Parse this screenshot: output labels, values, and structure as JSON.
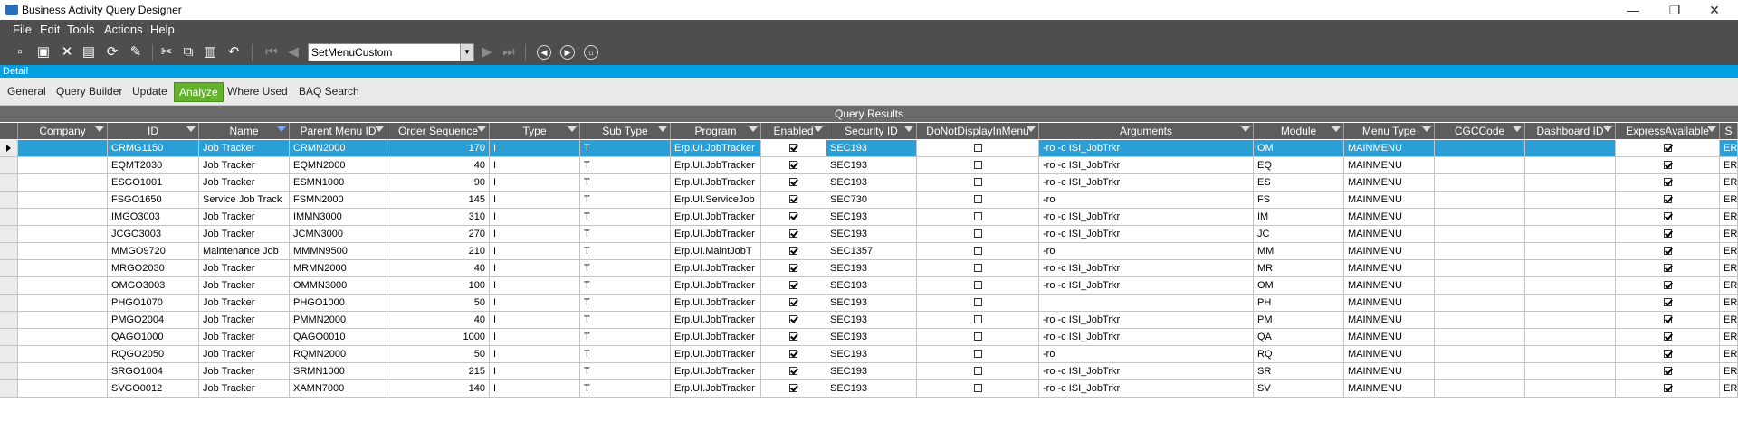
{
  "window": {
    "title": "Business Activity Query Designer",
    "minimize": "—",
    "restore": "❐",
    "close": "✕"
  },
  "menu": [
    "File",
    "Edit",
    "Tools",
    "Actions",
    "Help"
  ],
  "toolbar": {
    "selected_query": "SetMenuCustom"
  },
  "detail_label": "Detail",
  "tabs": [
    "General",
    "Query Builder",
    "Update",
    "Analyze",
    "Where Used",
    "BAQ Search"
  ],
  "active_tab": "Analyze",
  "grid": {
    "caption": "Query Results",
    "columns": [
      "Company",
      "ID",
      "Name",
      "Parent Menu ID",
      "Order Sequence",
      "Type",
      "Sub Type",
      "Program",
      "Enabled",
      "Security ID",
      "DoNotDisplayInMenu",
      "Arguments",
      "Module",
      "Menu Type",
      "CGCCode",
      "Dashboard ID",
      "ExpressAvailable",
      "S"
    ],
    "rows": [
      {
        "company": "",
        "id": "CRMG1150",
        "name": "Job Tracker",
        "parent": "CRMN2000",
        "order": "170",
        "type": "I",
        "subtype": "T",
        "program": "Erp.UI.JobTracker",
        "enabled": true,
        "security": "SEC193",
        "donotdisplay": false,
        "arguments": "-ro -c ISI_JobTrkr",
        "module": "OM",
        "menutype": "MAINMENU",
        "cgc": "",
        "dashboard": "",
        "express": true,
        "s": "ER"
      },
      {
        "company": "",
        "id": "EQMT2030",
        "name": "Job Tracker",
        "parent": "EQMN2000",
        "order": "40",
        "type": "I",
        "subtype": "T",
        "program": "Erp.UI.JobTracker",
        "enabled": true,
        "security": "SEC193",
        "donotdisplay": false,
        "arguments": "-ro -c ISI_JobTrkr",
        "module": "EQ",
        "menutype": "MAINMENU",
        "cgc": "",
        "dashboard": "",
        "express": true,
        "s": "ER"
      },
      {
        "company": "",
        "id": "ESGO1001",
        "name": "Job Tracker",
        "parent": "ESMN1000",
        "order": "90",
        "type": "I",
        "subtype": "T",
        "program": "Erp.UI.JobTracker",
        "enabled": true,
        "security": "SEC193",
        "donotdisplay": false,
        "arguments": "-ro -c ISI_JobTrkr",
        "module": "ES",
        "menutype": "MAINMENU",
        "cgc": "",
        "dashboard": "",
        "express": true,
        "s": "ER"
      },
      {
        "company": "",
        "id": "FSGO1650",
        "name": "Service Job Track",
        "parent": "FSMN2000",
        "order": "145",
        "type": "I",
        "subtype": "T",
        "program": "Erp.UI.ServiceJob",
        "enabled": true,
        "security": "SEC730",
        "donotdisplay": false,
        "arguments": "-ro",
        "module": "FS",
        "menutype": "MAINMENU",
        "cgc": "",
        "dashboard": "",
        "express": true,
        "s": "ER"
      },
      {
        "company": "",
        "id": "IMGO3003",
        "name": "Job Tracker",
        "parent": "IMMN3000",
        "order": "310",
        "type": "I",
        "subtype": "T",
        "program": "Erp.UI.JobTracker",
        "enabled": true,
        "security": "SEC193",
        "donotdisplay": false,
        "arguments": "-ro -c ISI_JobTrkr",
        "module": "IM",
        "menutype": "MAINMENU",
        "cgc": "",
        "dashboard": "",
        "express": true,
        "s": "ER"
      },
      {
        "company": "",
        "id": "JCGO3003",
        "name": "Job Tracker",
        "parent": "JCMN3000",
        "order": "270",
        "type": "I",
        "subtype": "T",
        "program": "Erp.UI.JobTracker",
        "enabled": true,
        "security": "SEC193",
        "donotdisplay": false,
        "arguments": "-ro -c ISI_JobTrkr",
        "module": "JC",
        "menutype": "MAINMENU",
        "cgc": "",
        "dashboard": "",
        "express": true,
        "s": "ER"
      },
      {
        "company": "",
        "id": "MMGO9720",
        "name": "Maintenance Job",
        "parent": "MMMN9500",
        "order": "210",
        "type": "I",
        "subtype": "T",
        "program": "Erp.UI.MaintJobT",
        "enabled": true,
        "security": "SEC1357",
        "donotdisplay": false,
        "arguments": "-ro",
        "module": "MM",
        "menutype": "MAINMENU",
        "cgc": "",
        "dashboard": "",
        "express": true,
        "s": "ER"
      },
      {
        "company": "",
        "id": "MRGO2030",
        "name": "Job Tracker",
        "parent": "MRMN2000",
        "order": "40",
        "type": "I",
        "subtype": "T",
        "program": "Erp.UI.JobTracker",
        "enabled": true,
        "security": "SEC193",
        "donotdisplay": false,
        "arguments": "-ro -c ISI_JobTrkr",
        "module": "MR",
        "menutype": "MAINMENU",
        "cgc": "",
        "dashboard": "",
        "express": true,
        "s": "ER"
      },
      {
        "company": "",
        "id": "OMGO3003",
        "name": "Job Tracker",
        "parent": "OMMN3000",
        "order": "100",
        "type": "I",
        "subtype": "T",
        "program": "Erp.UI.JobTracker",
        "enabled": true,
        "security": "SEC193",
        "donotdisplay": false,
        "arguments": "-ro -c ISI_JobTrkr",
        "module": "OM",
        "menutype": "MAINMENU",
        "cgc": "",
        "dashboard": "",
        "express": true,
        "s": "ER"
      },
      {
        "company": "",
        "id": "PHGO1070",
        "name": "Job Tracker",
        "parent": "PHGO1000",
        "order": "50",
        "type": "I",
        "subtype": "T",
        "program": "Erp.UI.JobTracker",
        "enabled": true,
        "security": "SEC193",
        "donotdisplay": false,
        "arguments": "",
        "module": "PH",
        "menutype": "MAINMENU",
        "cgc": "",
        "dashboard": "",
        "express": true,
        "s": "ER"
      },
      {
        "company": "",
        "id": "PMGO2004",
        "name": "Job Tracker",
        "parent": "PMMN2000",
        "order": "40",
        "type": "I",
        "subtype": "T",
        "program": "Erp.UI.JobTracker",
        "enabled": true,
        "security": "SEC193",
        "donotdisplay": false,
        "arguments": "-ro -c ISI_JobTrkr",
        "module": "PM",
        "menutype": "MAINMENU",
        "cgc": "",
        "dashboard": "",
        "express": true,
        "s": "ER"
      },
      {
        "company": "",
        "id": "QAGO1000",
        "name": "Job Tracker",
        "parent": "QAGO0010",
        "order": "1000",
        "type": "I",
        "subtype": "T",
        "program": "Erp.UI.JobTracker",
        "enabled": true,
        "security": "SEC193",
        "donotdisplay": false,
        "arguments": "-ro -c ISI_JobTrkr",
        "module": "QA",
        "menutype": "MAINMENU",
        "cgc": "",
        "dashboard": "",
        "express": true,
        "s": "ER"
      },
      {
        "company": "",
        "id": "RQGO2050",
        "name": "Job Tracker",
        "parent": "RQMN2000",
        "order": "50",
        "type": "I",
        "subtype": "T",
        "program": "Erp.UI.JobTracker",
        "enabled": true,
        "security": "SEC193",
        "donotdisplay": false,
        "arguments": "-ro",
        "module": "RQ",
        "menutype": "MAINMENU",
        "cgc": "",
        "dashboard": "",
        "express": true,
        "s": "ER"
      },
      {
        "company": "",
        "id": "SRGO1004",
        "name": "Job Tracker",
        "parent": "SRMN1000",
        "order": "215",
        "type": "I",
        "subtype": "T",
        "program": "Erp.UI.JobTracker",
        "enabled": true,
        "security": "SEC193",
        "donotdisplay": false,
        "arguments": "-ro -c ISI_JobTrkr",
        "module": "SR",
        "menutype": "MAINMENU",
        "cgc": "",
        "dashboard": "",
        "express": true,
        "s": "ER"
      },
      {
        "company": "",
        "id": "SVGO0012",
        "name": "Job Tracker",
        "parent": "XAMN7000",
        "order": "140",
        "type": "I",
        "subtype": "T",
        "program": "Erp.UI.JobTracker",
        "enabled": true,
        "security": "SEC193",
        "donotdisplay": false,
        "arguments": "-ro -c ISI_JobTrkr",
        "module": "SV",
        "menutype": "MAINMENU",
        "cgc": "",
        "dashboard": "",
        "express": true,
        "s": "ER"
      }
    ]
  },
  "colors": {
    "header_bg": "#5d5d5d",
    "menubar_bg": "#4e4e4e",
    "detail_bar": "#00a0e3",
    "active_tab": "#64b22e",
    "selection": "#2a9fd6"
  }
}
